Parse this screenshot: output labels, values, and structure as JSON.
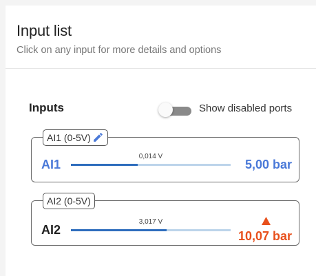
{
  "header": {
    "title": "Input list",
    "subtitle": "Click on any input for more details and options"
  },
  "inputs_section": {
    "label": "Inputs",
    "toggle": {
      "label": "Show disabled ports",
      "on": false
    }
  },
  "inputs": [
    {
      "tag": "AI1 (0-5V)",
      "name": "AI1",
      "reading": "0,014 V",
      "value": "5,00 bar",
      "level": 0.42,
      "name_color": "#4a79d8",
      "value_color": "#4a79d8",
      "editable": true,
      "alarm": false
    },
    {
      "tag": "AI2 (0-5V)",
      "name": "AI2",
      "reading": "3,017 V",
      "value": "10,07 bar",
      "level": 0.6,
      "name_color": "#222222",
      "value_color": "#e8501c",
      "editable": false,
      "alarm": true
    }
  ],
  "colors": {
    "accent": "#4a79d8",
    "alarm": "#e8501c",
    "bar_fill": "#2e6dbd",
    "bar_track": "#bcd4ea"
  },
  "icons": {
    "edit": "pencil-icon",
    "alarm": "warning-triangle-icon"
  }
}
